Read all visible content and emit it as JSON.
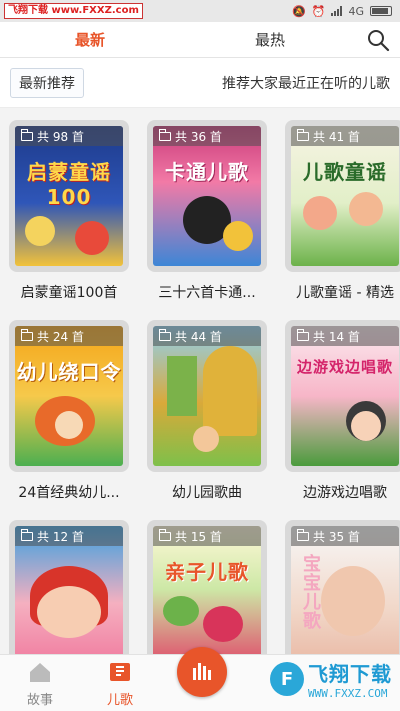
{
  "status_bar": {
    "watermark": "飞翔下载 www.FXXZ.com",
    "network": "4G",
    "icons": [
      "mute-icon",
      "alarm-icon",
      "signal-icon",
      "battery-icon"
    ]
  },
  "tabs": [
    {
      "label": "最新",
      "active": true
    },
    {
      "label": "最热",
      "active": false
    }
  ],
  "banner": {
    "chip": "最新推荐",
    "text": "推荐大家最近正在听的儿歌"
  },
  "albums": [
    {
      "label": "启蒙童谣100首",
      "count": "共 98 首",
      "cover_text": "启蒙童谣100"
    },
    {
      "label": "三十六首卡通...",
      "count": "共 36 首",
      "cover_text": "卡通儿歌"
    },
    {
      "label": "儿歌童谣 - 精选",
      "count": "共 41 首",
      "cover_text": "儿歌童谣"
    },
    {
      "label": "24首经典幼儿...",
      "count": "共 24 首",
      "cover_text": "幼儿绕口令"
    },
    {
      "label": "幼儿园歌曲",
      "count": "共 44 首",
      "cover_text": ""
    },
    {
      "label": "边游戏边唱歌",
      "count": "共 14 首",
      "cover_text": "边游戏边唱歌"
    },
    {
      "label": "",
      "count": "共 12 首",
      "cover_text": ""
    },
    {
      "label": "",
      "count": "共 15 首",
      "cover_text": "亲子儿歌"
    },
    {
      "label": "",
      "count": "共 35 首",
      "cover_text": "宝宝儿歌"
    }
  ],
  "bottom_nav": {
    "story": "故事",
    "song": "儿歌",
    "watermark_main": "飞翔下载",
    "watermark_sub": "WWW.FXXZ.COM"
  },
  "colors": {
    "accent": "#e8552a",
    "watermark_blue": "#1f9ad3"
  }
}
